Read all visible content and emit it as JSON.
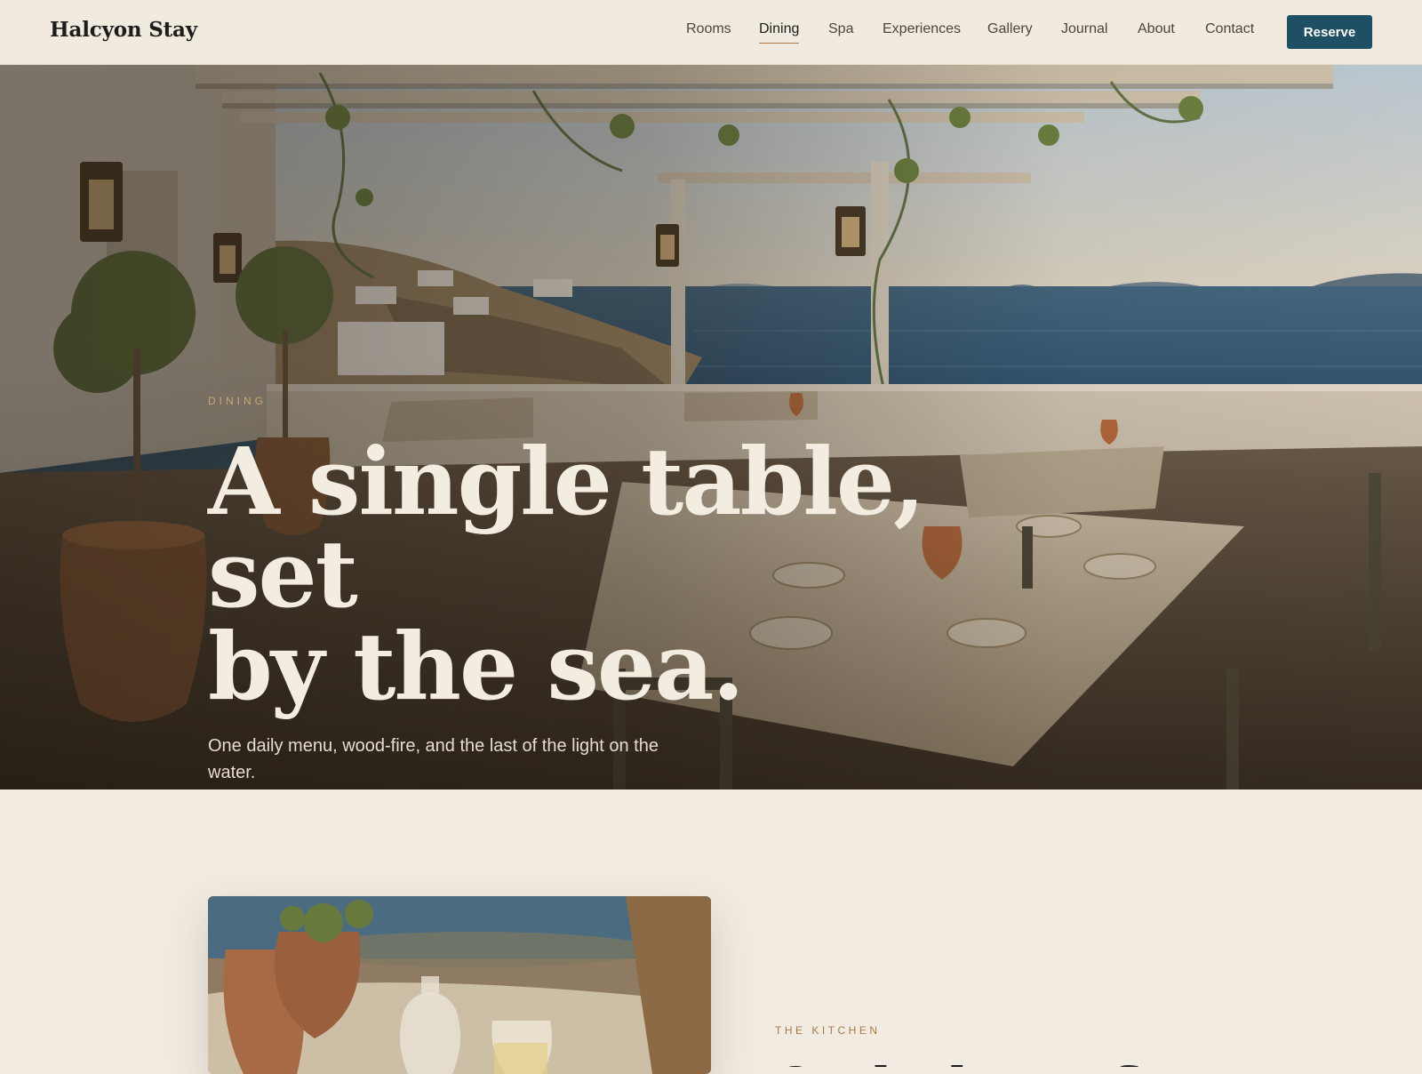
{
  "brand": {
    "name": "Halcyon Stay"
  },
  "nav": {
    "items": [
      {
        "label": "Rooms",
        "active": false
      },
      {
        "label": "Dining",
        "active": true
      },
      {
        "label": "Spa",
        "active": false
      },
      {
        "label": "Experiences",
        "active": false
      },
      {
        "label": "Gallery",
        "active": false
      },
      {
        "label": "Journal",
        "active": false
      },
      {
        "label": "About",
        "active": false
      },
      {
        "label": "Contact",
        "active": false
      }
    ],
    "cta_label": "Reserve"
  },
  "hero": {
    "eyebrow": "DINING",
    "title_lines": [
      "A single table, set",
      "by the sea."
    ],
    "subtitle": "One daily menu, wood-fire, and the last of the light on the water.",
    "image": "terrace dining tables under a pergola overlooking the sea"
  },
  "kitchen": {
    "eyebrow": "THE KITCHEN",
    "heading": "Cooked over fire",
    "image": "carafe and glass of white wine on a stone table"
  },
  "colors": {
    "page_background": "#f1ebe1",
    "header_background": "#f0eadf",
    "accent": "#1e4f63",
    "eyebrow_gold": "#a67a45",
    "hero_text": "#f3ece1"
  }
}
